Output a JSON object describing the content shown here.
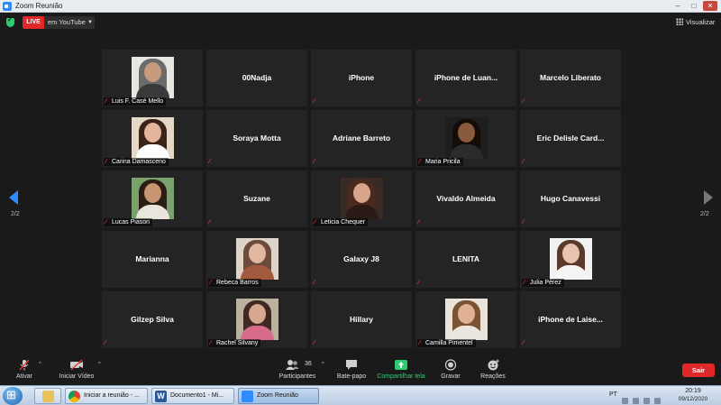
{
  "window": {
    "title": "Zoom Reunião"
  },
  "header": {
    "live_badge": "LIVE",
    "live_target": "em YouTube",
    "view_label": "Visualizar"
  },
  "pagination": {
    "left": "2/2",
    "right": "2/2"
  },
  "participants": [
    {
      "name": "Luis F. Casé Mello",
      "video": true,
      "muted": true,
      "photo": {
        "bg": "#e8e6e1",
        "skin": "#c79a7d",
        "hair": "#6b6b6b",
        "shirt": "#3a3a3a"
      }
    },
    {
      "name": "00Nadja",
      "video": false,
      "muted": false
    },
    {
      "name": "iPhone",
      "video": false,
      "muted": true
    },
    {
      "name": "iPhone de Luan...",
      "video": false,
      "muted": true
    },
    {
      "name": "Marcelo Liberato",
      "video": false,
      "muted": true
    },
    {
      "name": "Carina Damasceno",
      "video": true,
      "muted": true,
      "photo": {
        "bg": "#e5d7c8",
        "skin": "#e2b59c",
        "hair": "#3b2318",
        "shirt": "#ffffff"
      }
    },
    {
      "name": "Soraya Motta",
      "video": false,
      "muted": true
    },
    {
      "name": "Adriane Barreto",
      "video": false,
      "muted": true
    },
    {
      "name": "Maria Pricila",
      "video": true,
      "muted": true,
      "photo": {
        "bg": "#1e1e1e",
        "skin": "#8a5a3c",
        "hair": "#140c08",
        "shirt": "#2b2b2b"
      }
    },
    {
      "name": "Eric Delisle Card...",
      "video": false,
      "muted": true
    },
    {
      "name": "Lucas Piason",
      "video": true,
      "muted": true,
      "photo": {
        "bg": "#7aa26c",
        "skin": "#c89572",
        "hair": "#2a1d14",
        "shirt": "#e9e4dc"
      }
    },
    {
      "name": "Suzane",
      "video": false,
      "muted": true
    },
    {
      "name": "Leticia Chequer",
      "video": true,
      "muted": true,
      "photo": {
        "bg": "#3a2a26",
        "skin": "#d6a58a",
        "hair": "#4a2a1c",
        "shirt": "#2a1a18"
      }
    },
    {
      "name": "Vivaldo Almeida",
      "video": false,
      "muted": true
    },
    {
      "name": "Hugo Canavessi",
      "video": false,
      "muted": true
    },
    {
      "name": "Marianna",
      "video": false,
      "muted": false
    },
    {
      "name": "Rebeca Barros",
      "video": true,
      "muted": true,
      "photo": {
        "bg": "#dcd4c6",
        "skin": "#e3b8a0",
        "hair": "#6d4b3c",
        "shirt": "#a25a3f"
      }
    },
    {
      "name": "Galaxy J8",
      "video": false,
      "muted": true
    },
    {
      "name": "LENITA",
      "video": false,
      "muted": true
    },
    {
      "name": "Julia Pérez",
      "video": true,
      "muted": true,
      "photo": {
        "bg": "#f2f2f2",
        "skin": "#e9c3ae",
        "hair": "#5a3a2a",
        "shirt": "#f5f5f5"
      }
    },
    {
      "name": "Gilzep Silva",
      "video": false,
      "muted": true
    },
    {
      "name": "Rachel Silvany",
      "video": true,
      "muted": true,
      "photo": {
        "bg": "#bcb0a0",
        "skin": "#d9a890",
        "hair": "#3e2a22",
        "shirt": "#d86b8a"
      }
    },
    {
      "name": "Hillary",
      "video": false,
      "muted": true
    },
    {
      "name": "Camilla Pimentel",
      "video": true,
      "muted": true,
      "photo": {
        "bg": "#e9e3da",
        "skin": "#e0b293",
        "hair": "#7a5234",
        "shirt": "#ebe7e0"
      }
    },
    {
      "name": "iPhone de Laise...",
      "video": false,
      "muted": true
    }
  ],
  "toolbar": {
    "unmute": "Ativar",
    "start_video": "Iniciar Vídeo",
    "participants": "Participantes",
    "participant_count": "36",
    "chat": "Bate-papo",
    "share": "Compartilhar tela",
    "record": "Gravar",
    "reactions": "Reações",
    "leave": "Sair"
  },
  "taskbar": {
    "apps": [
      {
        "label": "",
        "color": "#e8c25a"
      },
      {
        "label": "Iniciar a reunião - ...",
        "color": "#e2a23a"
      },
      {
        "label": "Documento1 - Mi...",
        "color": "#2b5797"
      },
      {
        "label": "Zoom Reunião",
        "color": "#2d8cff",
        "active": true
      }
    ],
    "language": "PT",
    "time": "20:19",
    "date": "09/12/2020"
  },
  "colors": {
    "tile_bg": "#242424",
    "leave_red": "#e02828",
    "share_green": "#2ecc71",
    "muted_red": "#e53935",
    "accent_blue": "#2d8cff"
  }
}
